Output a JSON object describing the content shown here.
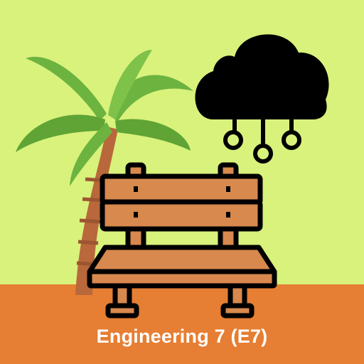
{
  "caption": "Engineering 7 (E7)",
  "icons": [
    "palm-tree-icon",
    "cloud-network-icon",
    "park-bench-icon"
  ],
  "colors": {
    "sky": "#d8f27c",
    "ground": "#e67e33",
    "caption": "#ffffff",
    "palm_leaf": "#6cb33f",
    "palm_trunk": "#b8683a",
    "bench_wood": "#d8894e",
    "outline": "#000000"
  }
}
